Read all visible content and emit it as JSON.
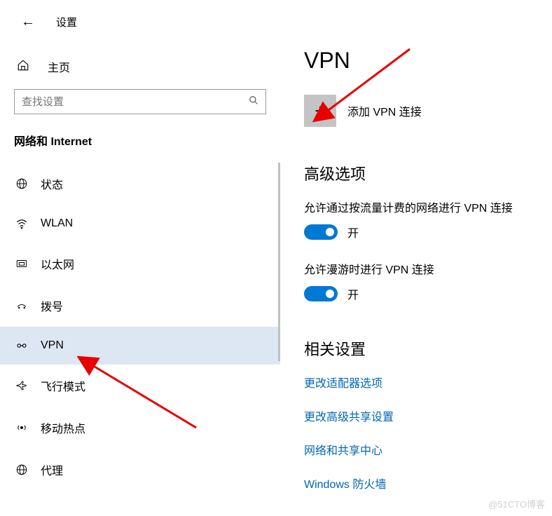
{
  "header": {
    "title": "设置"
  },
  "home": {
    "label": "主页"
  },
  "search": {
    "placeholder": "查找设置"
  },
  "section": {
    "title": "网络和 Internet"
  },
  "nav": {
    "items": [
      {
        "label": "状态"
      },
      {
        "label": "WLAN"
      },
      {
        "label": "以太网"
      },
      {
        "label": "拨号"
      },
      {
        "label": "VPN"
      },
      {
        "label": "飞行模式"
      },
      {
        "label": "移动热点"
      },
      {
        "label": "代理"
      }
    ]
  },
  "main": {
    "title": "VPN",
    "add_label": "添加 VPN 连接",
    "advanced_heading": "高级选项",
    "toggle1_label": "允许通过按流量计费的网络进行 VPN 连接",
    "toggle2_label": "允许漫游时进行 VPN 连接",
    "toggle_on": "开",
    "related_heading": "相关设置",
    "links": [
      "更改适配器选项",
      "更改高级共享设置",
      "网络和共享中心",
      "Windows 防火墙"
    ]
  },
  "watermark": "@51CTO博客"
}
